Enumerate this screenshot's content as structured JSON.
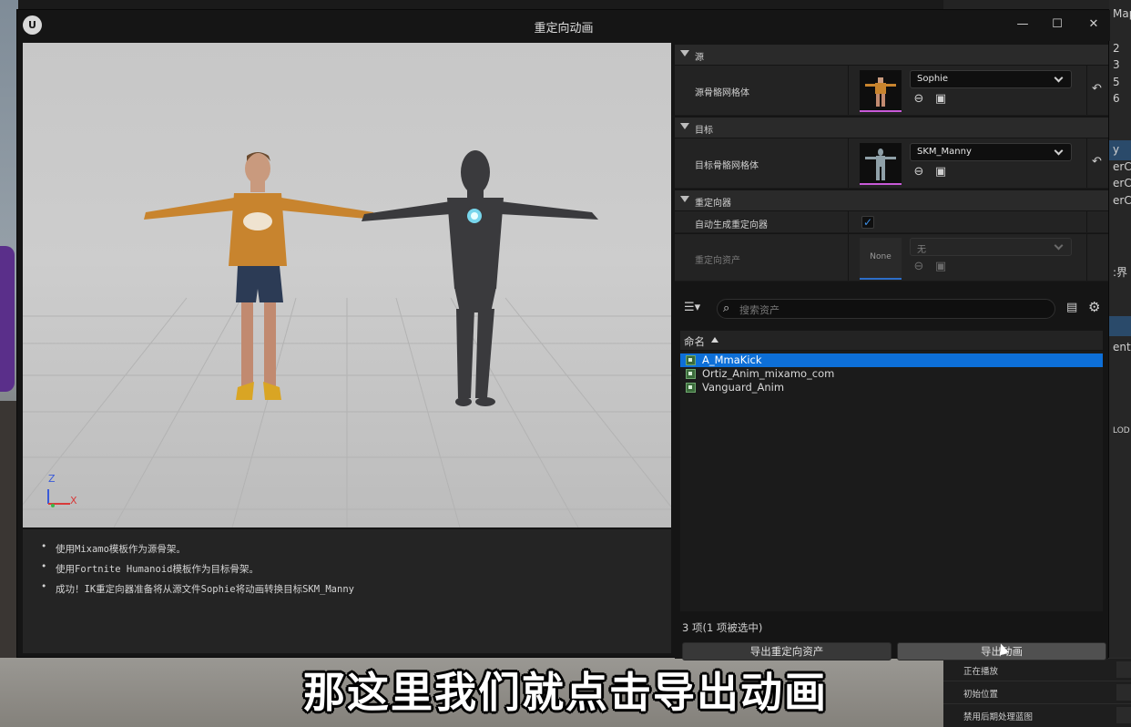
{
  "background": {
    "right_edge_texts": [
      "Map",
      "2",
      "3",
      "5",
      "6",
      "y",
      "erCu",
      "erCu",
      "erCu",
      ":界",
      "ent",
      "LOD"
    ],
    "panel_rows": [
      "正在播放",
      "初始位置",
      "禁用后期处理蓝图"
    ]
  },
  "window": {
    "title": "重定向动画",
    "logo": "U",
    "minimize": "—",
    "maximize": "☐",
    "close": "✕"
  },
  "viewport": {
    "axis_z": "Z",
    "axis_x": "X"
  },
  "log": {
    "lines": [
      "使用Mixamo模板作为源骨架。",
      "使用Fortnite Humanoid模板作为目标骨架。",
      "成功！IK重定向器准备将从源文件Sophie将动画转换目标SKM_Manny"
    ]
  },
  "source": {
    "header": "源",
    "label": "源骨骼网格体",
    "value": "Sophie"
  },
  "target": {
    "header": "目标",
    "label": "目标骨骼网格体",
    "value": "SKM_Manny"
  },
  "retargeter": {
    "header": "重定向器",
    "auto_label": "自动生成重定向器",
    "auto_checked": "✓",
    "asset_label": "重定向资产",
    "asset_thumb": "None",
    "asset_value": "无"
  },
  "search": {
    "placeholder": "搜索资产"
  },
  "assets": {
    "column": "命名",
    "items": [
      "A_MmaKick",
      "Ortiz_Anim_mixamo_com",
      "Vanguard_Anim"
    ],
    "selected": "A_MmaKick",
    "count": "3 项(1 项被选中)"
  },
  "buttons": {
    "export_retarget": "导出重定向资产",
    "export_anim": "导出动画"
  },
  "subtitle": "那这里我们就点击导出动画",
  "colors": {
    "selection": "#0d6fd8",
    "accent_pink": "#c85ad8",
    "check": "#3d8fe6"
  }
}
